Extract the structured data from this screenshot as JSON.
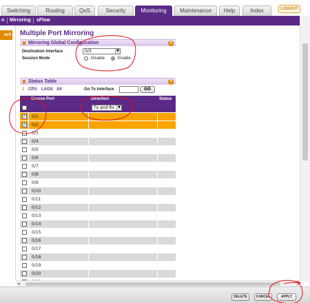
{
  "tabs": [
    "Switching",
    "Routing",
    "QoS",
    "Security",
    "Monitoring",
    "Maintenance",
    "Help",
    "Index"
  ],
  "active_tab": "Monitoring",
  "logout_label": "LOGOUT",
  "subnav": {
    "partial_left": "n",
    "mirroring": "Mirroring",
    "sflow": "sFlow"
  },
  "leftnav": {
    "active_partial": "ort"
  },
  "page_title": "Multiple Port Mirroring",
  "mirroring_section": {
    "title": "Mirroring Global Configuration",
    "help_icon": "?",
    "destination_label": "Destination Interface",
    "destination_value": "0/3",
    "session_label": "Session Mode",
    "disable_label": "Disable",
    "enable_label": "Enable",
    "session_mode": "Enable"
  },
  "status_section": {
    "title": "Status Table",
    "help_icon": "?",
    "filters": [
      "1",
      "CPU",
      "LAGS",
      "All"
    ],
    "goto_label": "Go To Interface",
    "goto_value": "",
    "go_label": "GO"
  },
  "table": {
    "columns": [
      "Source Port",
      "Direction",
      "Status"
    ],
    "header_direction_value": "Tx and Rx",
    "rows": [
      {
        "port": "0/1",
        "checked": true,
        "highlight": true
      },
      {
        "port": "0/2",
        "checked": true,
        "highlight": true
      },
      {
        "port": "0/3",
        "checked": false,
        "highlight": false
      },
      {
        "port": "0/4",
        "checked": false,
        "highlight": false
      },
      {
        "port": "0/5",
        "checked": false,
        "highlight": false
      },
      {
        "port": "0/6",
        "checked": false,
        "highlight": false
      },
      {
        "port": "0/7",
        "checked": false,
        "highlight": false
      },
      {
        "port": "0/8",
        "checked": false,
        "highlight": false
      },
      {
        "port": "0/9",
        "checked": false,
        "highlight": false
      },
      {
        "port": "0/10",
        "checked": false,
        "highlight": false
      },
      {
        "port": "0/11",
        "checked": false,
        "highlight": false
      },
      {
        "port": "0/12",
        "checked": false,
        "highlight": false
      },
      {
        "port": "0/13",
        "checked": false,
        "highlight": false
      },
      {
        "port": "0/14",
        "checked": false,
        "highlight": false
      },
      {
        "port": "0/15",
        "checked": false,
        "highlight": false
      },
      {
        "port": "0/16",
        "checked": false,
        "highlight": false
      },
      {
        "port": "0/17",
        "checked": false,
        "highlight": false
      },
      {
        "port": "0/18",
        "checked": false,
        "highlight": false
      },
      {
        "port": "0/19",
        "checked": false,
        "highlight": false
      },
      {
        "port": "0/20",
        "checked": false,
        "highlight": false
      },
      {
        "port": "0/21",
        "checked": false,
        "highlight": false
      }
    ]
  },
  "buttons": {
    "delete": "DELETE",
    "cancel": "CANCEL",
    "apply": "APPLY"
  },
  "colors": {
    "brand_purple": "#5a2a86",
    "accent_orange": "#e08a00",
    "selected_row": "#f7a300",
    "annotation_red": "#e01010"
  }
}
